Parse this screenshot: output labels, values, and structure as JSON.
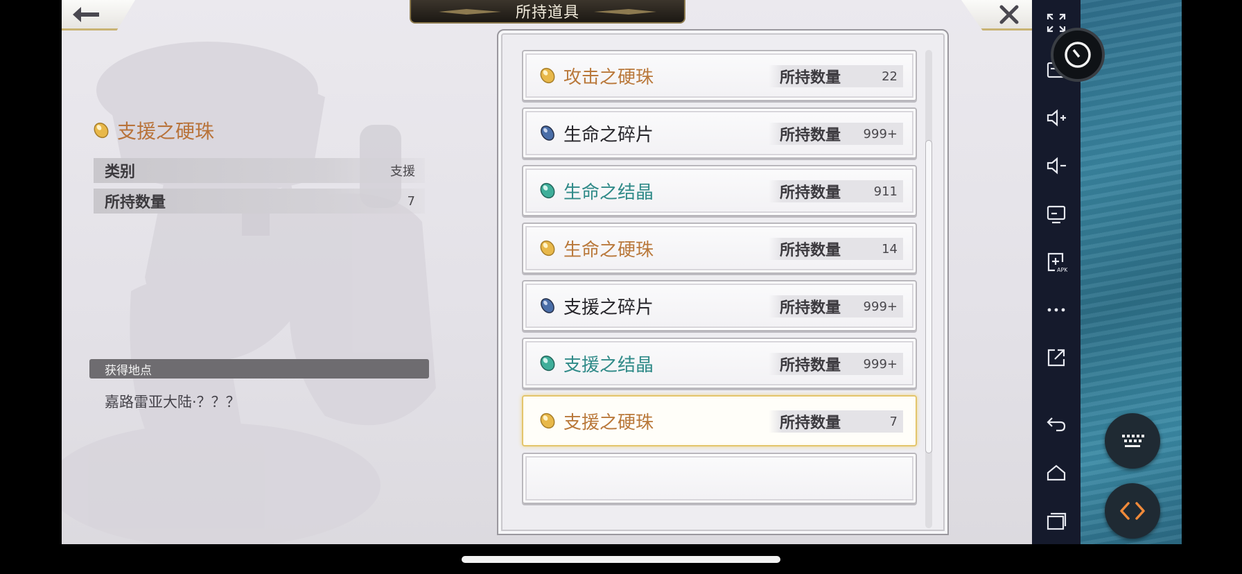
{
  "header": {
    "title": "所持道具"
  },
  "detail": {
    "name": "支援之硬珠",
    "rows": [
      {
        "label": "类别",
        "value": "支援"
      },
      {
        "label": "所持数量",
        "value": "7"
      }
    ],
    "source_header": "获得地点",
    "source_text": "嘉路雷亚大陆·？？？"
  },
  "items": [
    {
      "name": "攻击之硬珠",
      "qty_label": "所持数量",
      "qty": "22",
      "gem": "orange",
      "color": "#b9783a"
    },
    {
      "name": "生命之碎片",
      "qty_label": "所持数量",
      "qty": "999+",
      "gem": "blue",
      "color": "#26252a"
    },
    {
      "name": "生命之结晶",
      "qty_label": "所持数量",
      "qty": "911",
      "gem": "teal",
      "color": "#2f8a88"
    },
    {
      "name": "生命之硬珠",
      "qty_label": "所持数量",
      "qty": "14",
      "gem": "orange",
      "color": "#b9783a"
    },
    {
      "name": "支援之碎片",
      "qty_label": "所持数量",
      "qty": "999+",
      "gem": "blue",
      "color": "#26252a"
    },
    {
      "name": "支援之结晶",
      "qty_label": "所持数量",
      "qty": "999+",
      "gem": "teal",
      "color": "#2f8a88"
    },
    {
      "name": "支援之硬珠",
      "qty_label": "所持数量",
      "qty": "7",
      "gem": "orange",
      "color": "#b9783a",
      "selected": true
    }
  ],
  "scroll": {
    "position_fraction": 0.25,
    "visible_fraction": 0.66
  },
  "emulator_sidebar": {
    "buttons": [
      "fullscreen-icon",
      "screenshot-icon",
      "volume-up-icon",
      "volume-down-icon",
      "display-icon",
      "install-apk-icon",
      "more-icon",
      "open-external-icon",
      "back-icon",
      "home-icon",
      "recents-icon"
    ]
  },
  "floating": {
    "buttons": [
      "clock-icon",
      "keyboard-icon",
      "code-icon"
    ]
  },
  "colors": {
    "gem_orange": "#e8b84a",
    "gem_blue": "#4a6ea8",
    "gem_teal": "#3fae9a",
    "selection_border": "#e3c56c"
  }
}
